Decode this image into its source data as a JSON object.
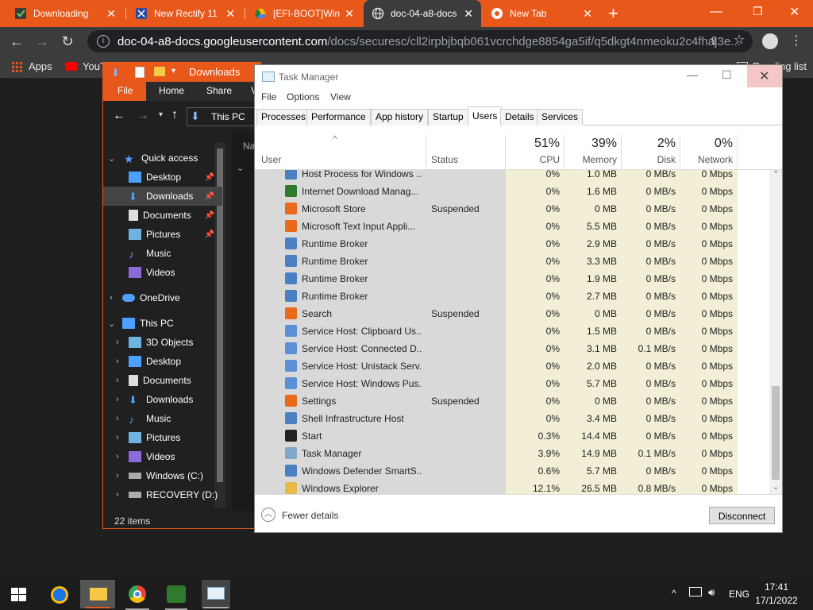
{
  "chrome": {
    "tabs": [
      {
        "title": "Downloading"
      },
      {
        "title": "New Rectify 11"
      },
      {
        "title": "[EFI-BOOT]Win"
      },
      {
        "title": "doc-04-a8-docs"
      },
      {
        "title": "New Tab"
      }
    ],
    "new_tab_glyph": "+",
    "url_host": "doc-04-a8-docs.googleusercontent.com",
    "url_path": "/docs/securesc/cll2irpbjbqb061vcrchdge8854ga5if/q5dkgt4nmeoku2c4fhaj3e...",
    "bookmarks": [
      "Apps",
      "YouT"
    ],
    "reading_list": "Reading list"
  },
  "explorer": {
    "title": "Downloads",
    "ribbon": [
      "File",
      "Home",
      "Share",
      "V"
    ],
    "breadcrumb": "This PC",
    "quick_access": "Quick access",
    "qa_items": [
      "Desktop",
      "Downloads",
      "Documents",
      "Pictures",
      "Music",
      "Videos"
    ],
    "onedrive": "OneDrive",
    "this_pc": "This PC",
    "pc_items": [
      "3D Objects",
      "Desktop",
      "Documents",
      "Downloads",
      "Music",
      "Pictures",
      "Videos",
      "Windows (C:)",
      "RECOVERY (D:)"
    ],
    "status": "22 items"
  },
  "taskmanager": {
    "title": "Task Manager",
    "menu": [
      "File",
      "Options",
      "View"
    ],
    "tabs": [
      "Processes",
      "Performance",
      "App history",
      "Startup",
      "Users",
      "Details",
      "Services"
    ],
    "active_tab": "Users",
    "columns": {
      "user": "User",
      "status": "Status",
      "cpu_pct": "51%",
      "cpu": "CPU",
      "mem_pct": "39%",
      "mem": "Memory",
      "disk_pct": "2%",
      "disk": "Disk",
      "net_pct": "0%",
      "net": "Network"
    },
    "rows": [
      {
        "name": "Host Process for Windows ...",
        "status": "",
        "cpu": "0%",
        "mem": "1.0 MB",
        "disk": "0 MB/s",
        "net": "0 Mbps",
        "icon": "#4a7fc1"
      },
      {
        "name": "Internet Download Manag...",
        "status": "",
        "cpu": "0%",
        "mem": "1.6 MB",
        "disk": "0 MB/s",
        "net": "0 Mbps",
        "icon": "#2f7a2f"
      },
      {
        "name": "Microsoft Store",
        "status": "Suspended",
        "cpu": "0%",
        "mem": "0 MB",
        "disk": "0 MB/s",
        "net": "0 Mbps",
        "icon": "#e86a1a"
      },
      {
        "name": "Microsoft Text Input Appli...",
        "status": "",
        "cpu": "0%",
        "mem": "5.5 MB",
        "disk": "0 MB/s",
        "net": "0 Mbps",
        "icon": "#e86a1a"
      },
      {
        "name": "Runtime Broker",
        "status": "",
        "cpu": "0%",
        "mem": "2.9 MB",
        "disk": "0 MB/s",
        "net": "0 Mbps",
        "icon": "#4a7fc1"
      },
      {
        "name": "Runtime Broker",
        "status": "",
        "cpu": "0%",
        "mem": "3.3 MB",
        "disk": "0 MB/s",
        "net": "0 Mbps",
        "icon": "#4a7fc1"
      },
      {
        "name": "Runtime Broker",
        "status": "",
        "cpu": "0%",
        "mem": "1.9 MB",
        "disk": "0 MB/s",
        "net": "0 Mbps",
        "icon": "#4a7fc1"
      },
      {
        "name": "Runtime Broker",
        "status": "",
        "cpu": "0%",
        "mem": "2.7 MB",
        "disk": "0 MB/s",
        "net": "0 Mbps",
        "icon": "#4a7fc1"
      },
      {
        "name": "Search",
        "status": "Suspended",
        "cpu": "0%",
        "mem": "0 MB",
        "disk": "0 MB/s",
        "net": "0 Mbps",
        "icon": "#e86a1a"
      },
      {
        "name": "Service Host: Clipboard Us...",
        "status": "",
        "cpu": "0%",
        "mem": "1.5 MB",
        "disk": "0 MB/s",
        "net": "0 Mbps",
        "icon": "#5b8fd6"
      },
      {
        "name": "Service Host: Connected D...",
        "status": "",
        "cpu": "0%",
        "mem": "3.1 MB",
        "disk": "0.1 MB/s",
        "net": "0 Mbps",
        "icon": "#5b8fd6"
      },
      {
        "name": "Service Host: Unistack Serv...",
        "status": "",
        "cpu": "0%",
        "mem": "2.0 MB",
        "disk": "0 MB/s",
        "net": "0 Mbps",
        "icon": "#5b8fd6"
      },
      {
        "name": "Service Host: Windows Pus...",
        "status": "",
        "cpu": "0%",
        "mem": "5.7 MB",
        "disk": "0 MB/s",
        "net": "0 Mbps",
        "icon": "#5b8fd6"
      },
      {
        "name": "Settings",
        "status": "Suspended",
        "cpu": "0%",
        "mem": "0 MB",
        "disk": "0 MB/s",
        "net": "0 Mbps",
        "icon": "#e86a1a"
      },
      {
        "name": "Shell Infrastructure Host",
        "status": "",
        "cpu": "0%",
        "mem": "3.4 MB",
        "disk": "0 MB/s",
        "net": "0 Mbps",
        "icon": "#4a7fc1"
      },
      {
        "name": "Start",
        "status": "",
        "cpu": "0.3%",
        "mem": "14.4 MB",
        "disk": "0 MB/s",
        "net": "0 Mbps",
        "icon": "#222222"
      },
      {
        "name": "Task Manager",
        "status": "",
        "cpu": "3.9%",
        "mem": "14.9 MB",
        "disk": "0.1 MB/s",
        "net": "0 Mbps",
        "icon": "#7fa7c9"
      },
      {
        "name": "Windows Defender SmartS...",
        "status": "",
        "cpu": "0.6%",
        "mem": "5.7 MB",
        "disk": "0 MB/s",
        "net": "0 Mbps",
        "icon": "#4a7fc1"
      },
      {
        "name": "Windows Explorer",
        "status": "",
        "cpu": "12.1%",
        "mem": "26.5 MB",
        "disk": "0.8 MB/s",
        "net": "0 Mbps",
        "icon": "#e8b84a"
      }
    ],
    "fewer_details": "Fewer details",
    "disconnect": "Disconnect"
  },
  "taskbar": {
    "lang": "ENG",
    "time": "17:41",
    "date": "17/1/2022"
  },
  "colors": {
    "chrome_accent": "#e8581a",
    "explorer_accent": "#e8581a",
    "tm_heat_light": "#fdf7d8",
    "tm_row_selected": "#d9d9d9"
  }
}
